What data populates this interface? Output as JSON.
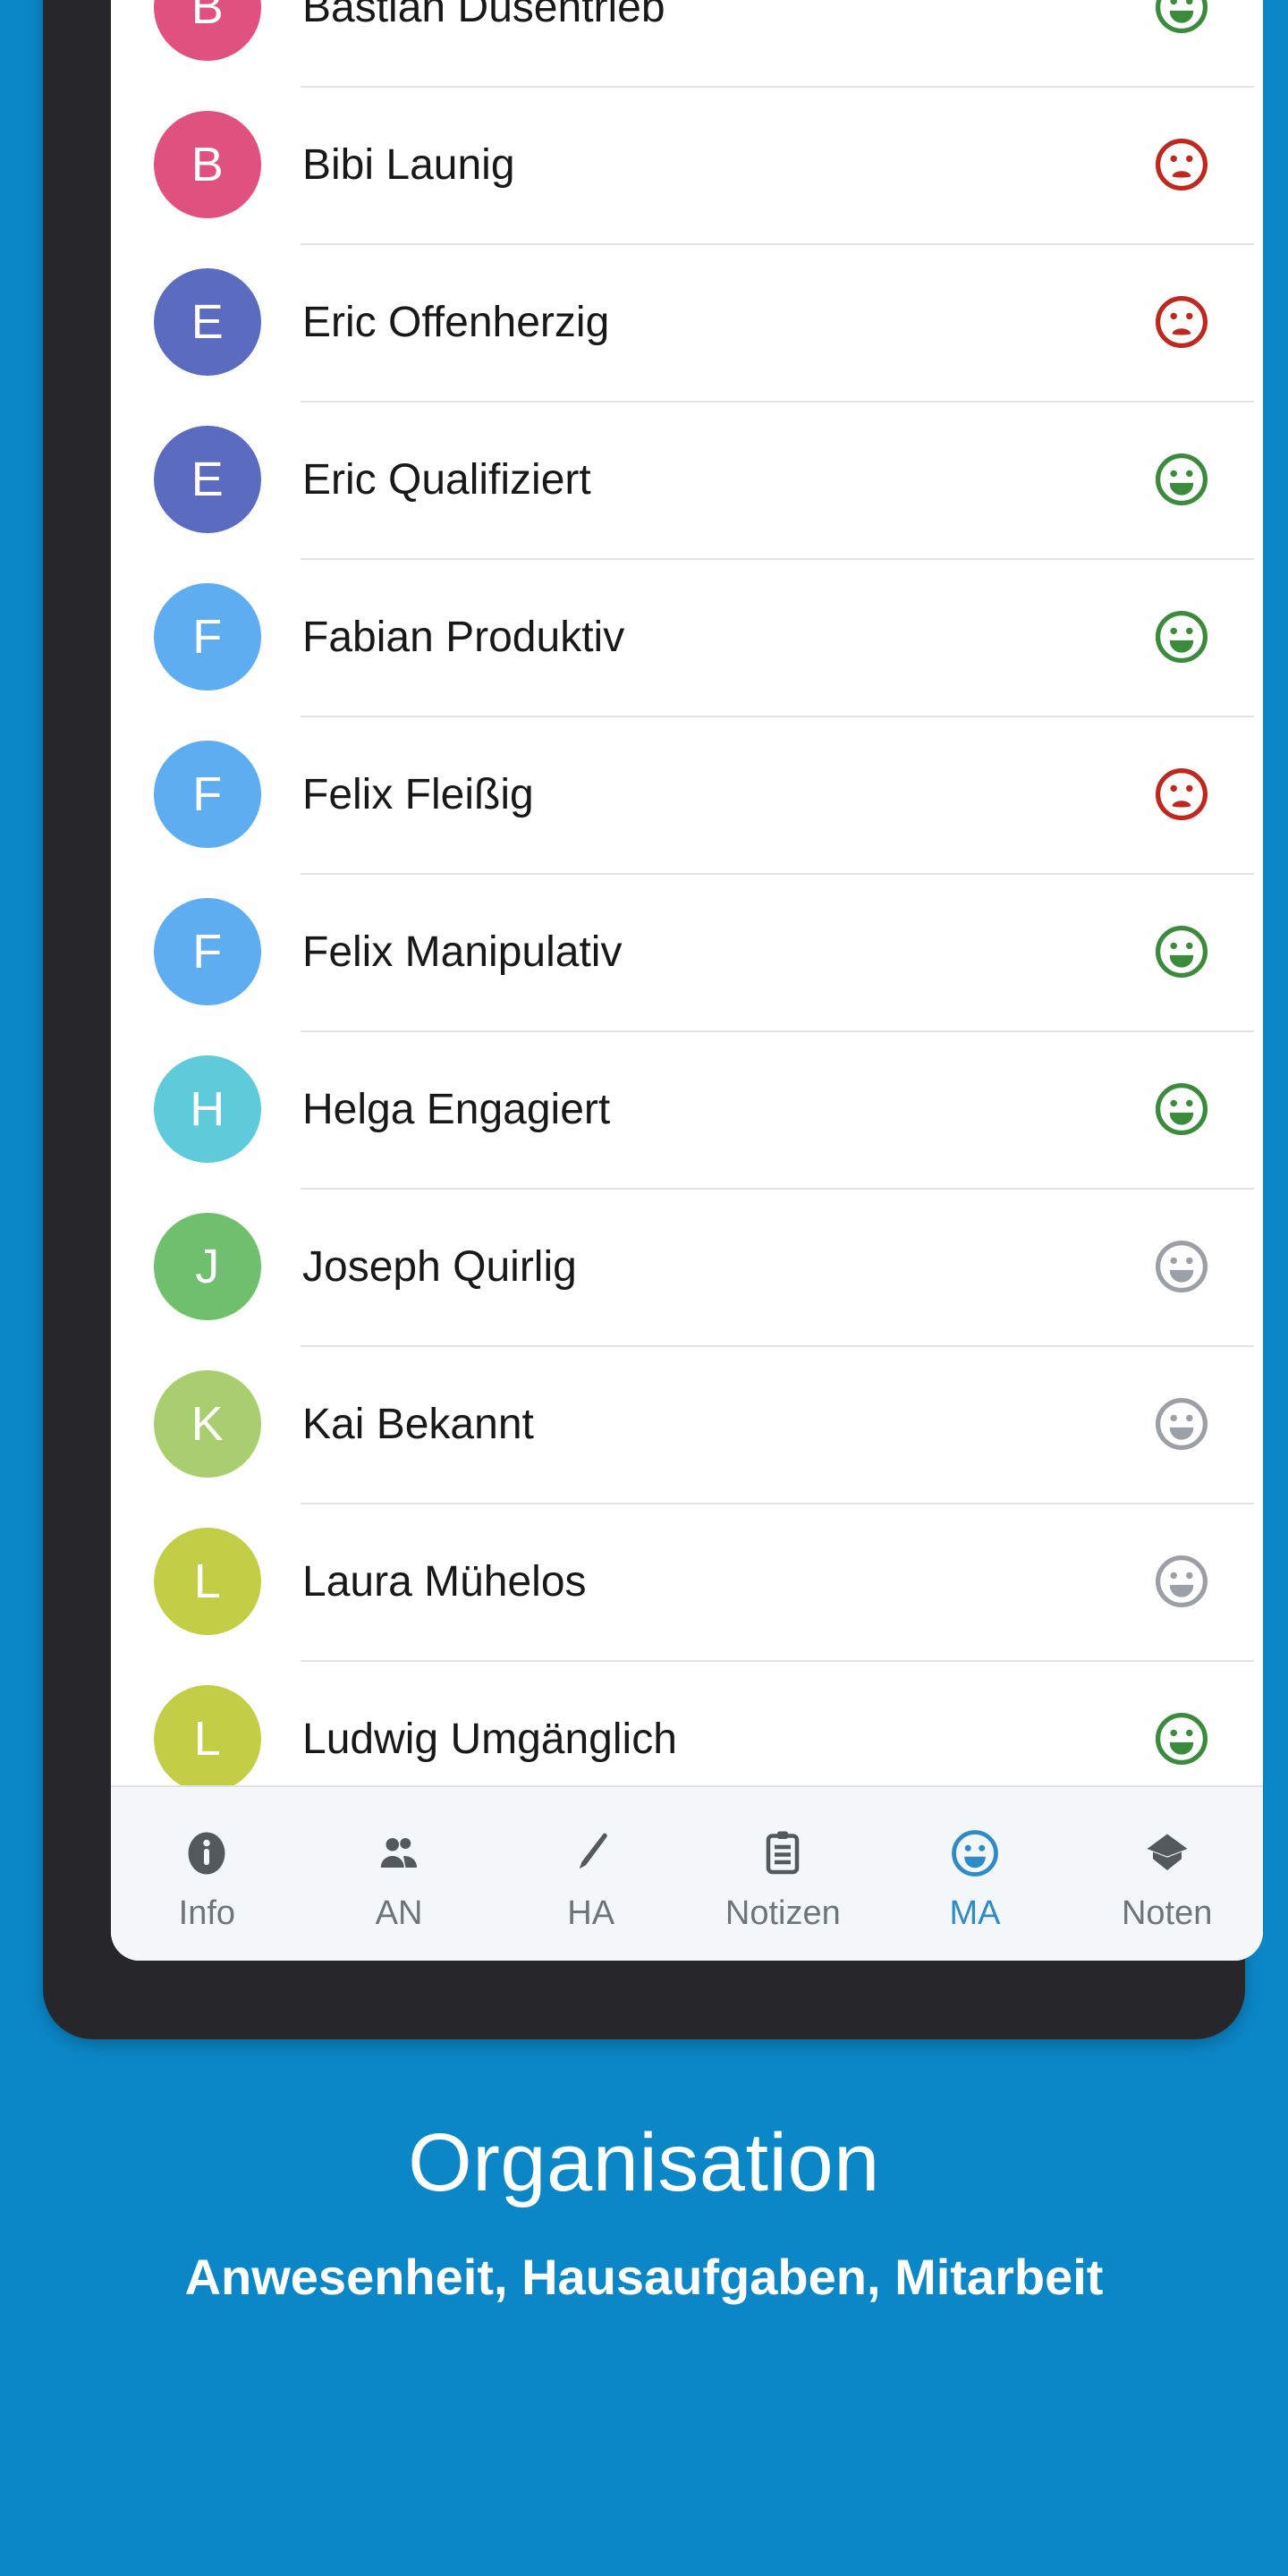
{
  "theme": {
    "background": "#0b87c8",
    "frame": "#26262b",
    "screen": "#ffffff",
    "tabbar_bg": "#f4f7f9",
    "accent": "#2e8bc8",
    "face_happy": "#3c8a3c",
    "face_sad": "#c0271f",
    "face_neutral": "#9aa0a6",
    "divider": "#e3e3e3"
  },
  "screen": {
    "list": {
      "name": "Mitarbeit student list",
      "rows": [
        {
          "initial": "B",
          "name": "Bastian Düsentrieb",
          "avatar_color": "#e0517f",
          "rating": "happy"
        },
        {
          "initial": "B",
          "name": "Bibi Launig",
          "avatar_color": "#e0517f",
          "rating": "sad"
        },
        {
          "initial": "E",
          "name": "Eric Offenherzig",
          "avatar_color": "#5b6bc0",
          "rating": "sad"
        },
        {
          "initial": "E",
          "name": "Eric Qualifiziert",
          "avatar_color": "#5b6bc0",
          "rating": "happy"
        },
        {
          "initial": "F",
          "name": "Fabian Produktiv",
          "avatar_color": "#5dadf0",
          "rating": "happy"
        },
        {
          "initial": "F",
          "name": "Felix Fleißig",
          "avatar_color": "#5dadf0",
          "rating": "sad"
        },
        {
          "initial": "F",
          "name": "Felix Manipulativ",
          "avatar_color": "#5dadf0",
          "rating": "happy"
        },
        {
          "initial": "H",
          "name": "Helga Engagiert",
          "avatar_color": "#5ecada",
          "rating": "happy"
        },
        {
          "initial": "J",
          "name": "Joseph Quirlig",
          "avatar_color": "#6fbf6f",
          "rating": "neutral"
        },
        {
          "initial": "K",
          "name": "Kai Bekannt",
          "avatar_color": "#a8ce6f",
          "rating": "neutral"
        },
        {
          "initial": "L",
          "name": "Laura Mühelos",
          "avatar_color": "#c3cd46",
          "rating": "neutral"
        },
        {
          "initial": "L",
          "name": "Ludwig Umgänglich",
          "avatar_color": "#c3cd46",
          "rating": "happy"
        }
      ]
    },
    "tabbar": {
      "active_index": 4,
      "tabs": [
        {
          "label": "Info",
          "icon": "info-icon"
        },
        {
          "label": "AN",
          "icon": "people-icon"
        },
        {
          "label": "HA",
          "icon": "pencil-icon"
        },
        {
          "label": "Notizen",
          "icon": "clipboard-icon"
        },
        {
          "label": "MA",
          "icon": "smiley-icon"
        },
        {
          "label": "Noten",
          "icon": "graduation-cap-icon"
        }
      ]
    }
  },
  "caption": {
    "title": "Organisation",
    "subtitle": "Anwesenheit, Hausaufgaben, Mitarbeit"
  }
}
